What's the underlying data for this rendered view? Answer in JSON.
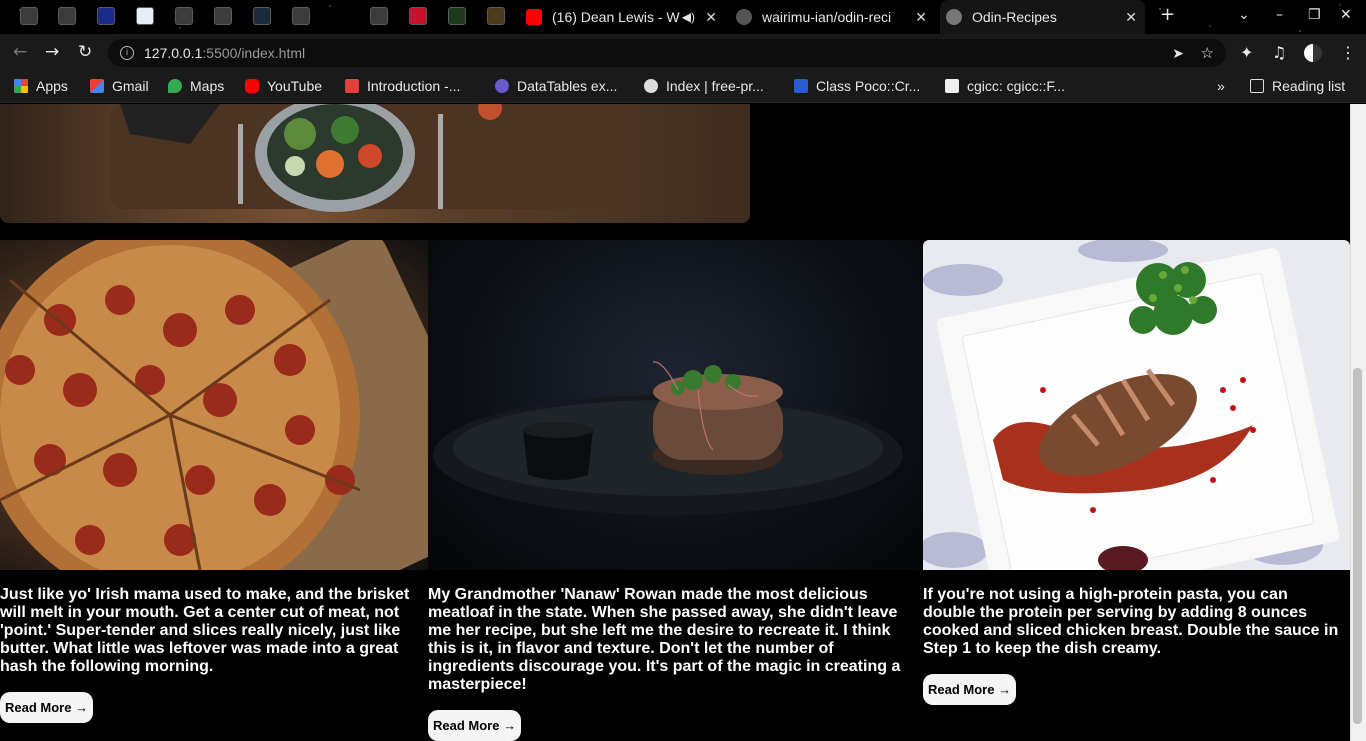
{
  "browser": {
    "tabs": [
      {
        "title": "(16) Dean Lewis - W",
        "favicon": "youtube-icon",
        "muted_icon": "speaker-icon"
      },
      {
        "title": "wairimu-ian/odin-reci",
        "favicon": "github-icon"
      },
      {
        "title": "Odin-Recipes",
        "favicon": "globe-icon",
        "active": true
      }
    ],
    "url_host": "127.0.0.1",
    "url_path": ":5500/index.html",
    "bookmarks": [
      {
        "label": "Apps",
        "icon": "apps-grid-icon"
      },
      {
        "label": "Gmail",
        "icon": "gmail-icon"
      },
      {
        "label": "Maps",
        "icon": "maps-icon"
      },
      {
        "label": "YouTube",
        "icon": "youtube-icon"
      },
      {
        "label": "Introduction -...",
        "icon": "book-icon"
      },
      {
        "label": "DataTables ex...",
        "icon": "datatables-icon"
      },
      {
        "label": "Index | free-pr...",
        "icon": "globe-icon"
      },
      {
        "label": "Class Poco::Cr...",
        "icon": "poco-icon"
      },
      {
        "label": "cgicc: cgicc::F...",
        "icon": "cgicc-icon"
      }
    ],
    "reading_list": "Reading list"
  },
  "page": {
    "cards": [
      {
        "image": "pizza-photo",
        "text": "Just like yo' Irish mama used to make, and the brisket will melt in your mouth. Get a center cut of meat, not 'point.' Super-tender and slices really nicely, just like butter. What little was leftover was made into a great hash the following morning.",
        "button": "Read More →"
      },
      {
        "image": "steak-photo",
        "text": "My Grandmother 'Nanaw' Rowan made the most delicious meatloaf in the state. When she passed away, she didn't leave me her recipe, but she left me the desire to recreate it. I think this is it, in flavor and texture. Don't let the number of ingredients discourage you. It's part of the magic in creating a masterpiece!",
        "button": "Read More →"
      },
      {
        "image": "duck-photo",
        "text": "If you're not using a high-protein pasta, you can double the protein per serving by adding 8 ounces cooked and sliced chicken breast. Double the sauce in Step 1 to keep the dish creamy.",
        "button": "Read More →"
      }
    ]
  }
}
